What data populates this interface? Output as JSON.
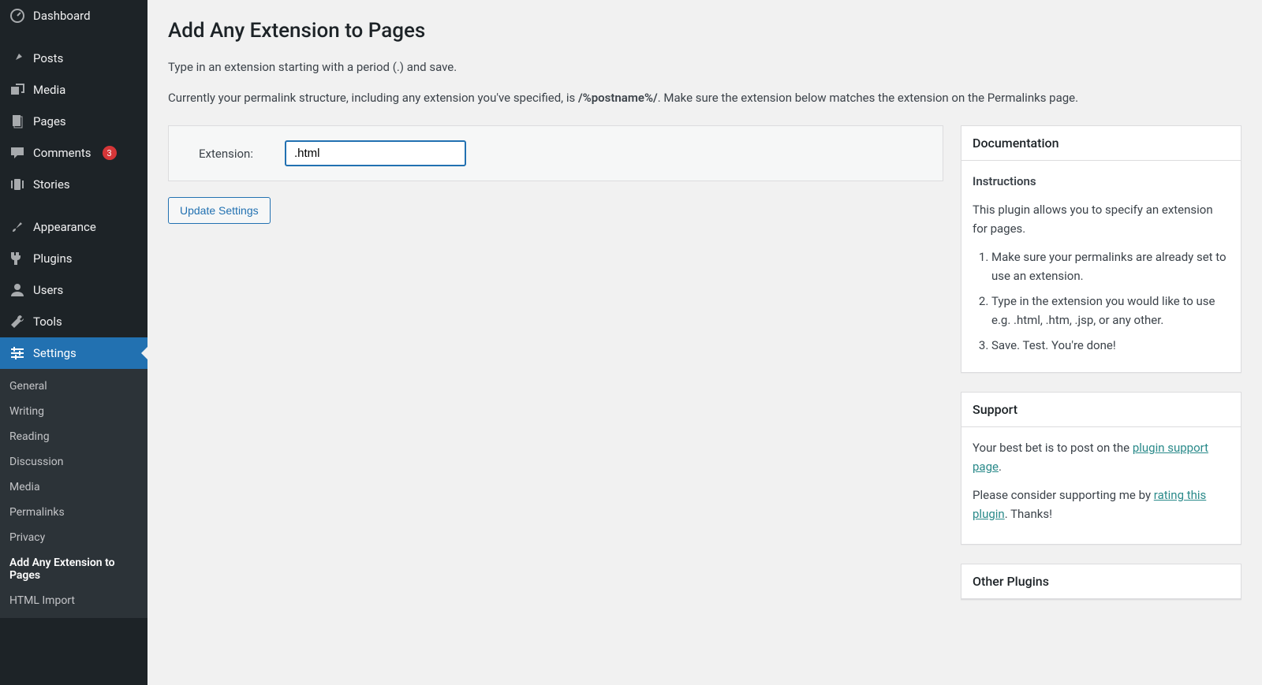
{
  "sidebar": {
    "items": [
      {
        "icon": "dashboard",
        "label": "Dashboard"
      },
      {
        "icon": "pin",
        "label": "Posts"
      },
      {
        "icon": "media",
        "label": "Media"
      },
      {
        "icon": "page",
        "label": "Pages"
      },
      {
        "icon": "comment",
        "label": "Comments",
        "badge": "3"
      },
      {
        "icon": "stories",
        "label": "Stories"
      },
      {
        "icon": "brush",
        "label": "Appearance"
      },
      {
        "icon": "plug",
        "label": "Plugins"
      },
      {
        "icon": "user",
        "label": "Users"
      },
      {
        "icon": "wrench",
        "label": "Tools"
      },
      {
        "icon": "sliders",
        "label": "Settings",
        "active": true
      }
    ],
    "submenu": [
      "General",
      "Writing",
      "Reading",
      "Discussion",
      "Media",
      "Permalinks",
      "Privacy",
      "Add Any Extension to Pages",
      "HTML Import"
    ],
    "submenu_current": "Add Any Extension to Pages"
  },
  "main": {
    "title": "Add Any Extension to Pages",
    "intro1": "Type in an extension starting with a period (.) and save.",
    "intro2_a": "Currently your permalink structure, including any extension you've specified, is ",
    "intro2_strong": "/%postname%/",
    "intro2_b": ". Make sure the extension below matches the extension on the Permalinks page.",
    "form": {
      "label": "Extension:",
      "value": ".html"
    },
    "submit_label": "Update Settings"
  },
  "panels": {
    "doc": {
      "title": "Documentation",
      "sub": "Instructions",
      "lead": "This plugin allows you to specify an extension for pages.",
      "steps": [
        "Make sure your permalinks are already set to use an extension.",
        "Type in the extension you would like to use e.g. .html, .htm, .jsp, or any other.",
        "Save. Test. You're done!"
      ]
    },
    "support": {
      "title": "Support",
      "p1_a": "Your best bet is to post on the ",
      "p1_link": "plugin support page",
      "p1_b": ".",
      "p2_a": "Please consider supporting me by ",
      "p2_link": "rating this plugin",
      "p2_b": ". Thanks!"
    },
    "other": {
      "title": "Other Plugins"
    }
  }
}
